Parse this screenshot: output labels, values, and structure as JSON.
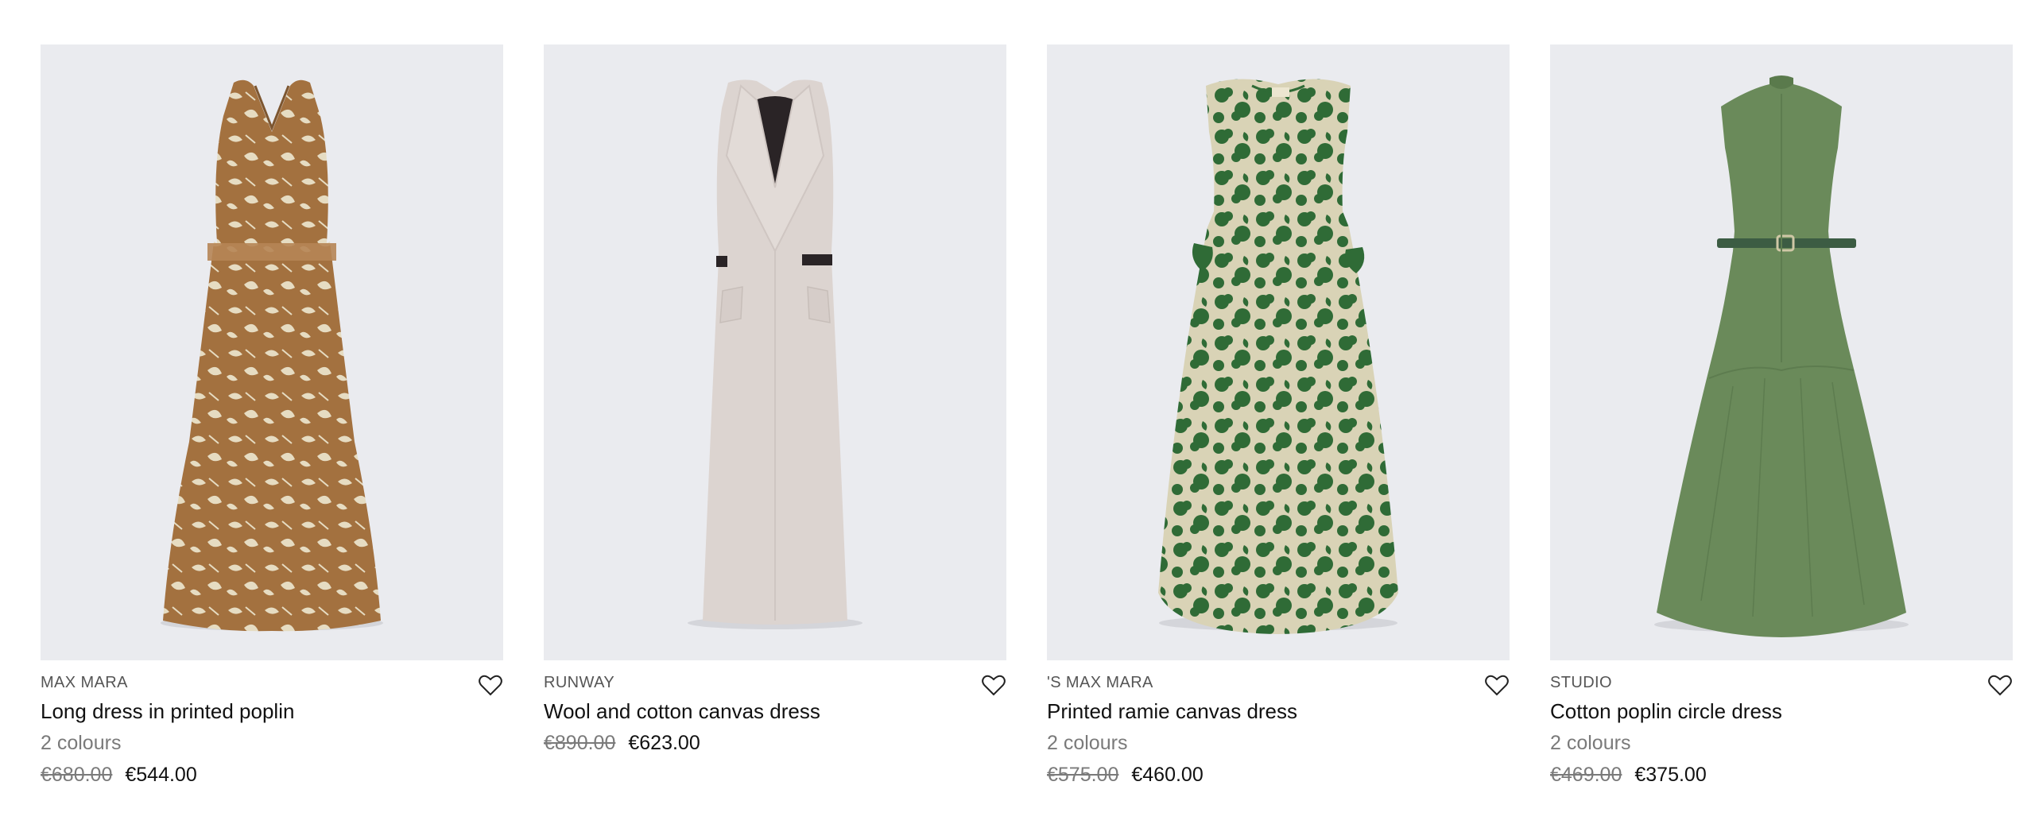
{
  "products": [
    {
      "brand": "MAX MARA",
      "name": "Long dress in printed poplin",
      "colours": "2 colours",
      "old_price": "€680.00",
      "new_price": "€544.00",
      "image_icon": "halter-printed-dress-image",
      "colors": {
        "main": "#a3713f",
        "pattern": "#e6dcc2"
      }
    },
    {
      "brand": "RUNWAY",
      "name": "Wool and cotton canvas dress",
      "colours": "",
      "old_price": "€890.00",
      "new_price": "€623.00",
      "image_icon": "sleeveless-coat-dress-image",
      "colors": {
        "main": "#dcd4d0",
        "accent": "#2a2426"
      }
    },
    {
      "brand": "'S MAX MARA",
      "name": "Printed ramie canvas dress",
      "colours": "2 colours",
      "old_price": "€575.00",
      "new_price": "€460.00",
      "image_icon": "floral-print-dress-image",
      "colors": {
        "main": "#d9d3b6",
        "pattern": "#2f6b36"
      }
    },
    {
      "brand": "STUDIO",
      "name": "Cotton poplin circle dress",
      "colours": "2 colours",
      "old_price": "€469.00",
      "new_price": "€375.00",
      "image_icon": "belted-circle-dress-image",
      "colors": {
        "main": "#6a8a5a",
        "accent": "#3c5c43"
      }
    }
  ],
  "wishlist_icon": "heart-outline-icon"
}
